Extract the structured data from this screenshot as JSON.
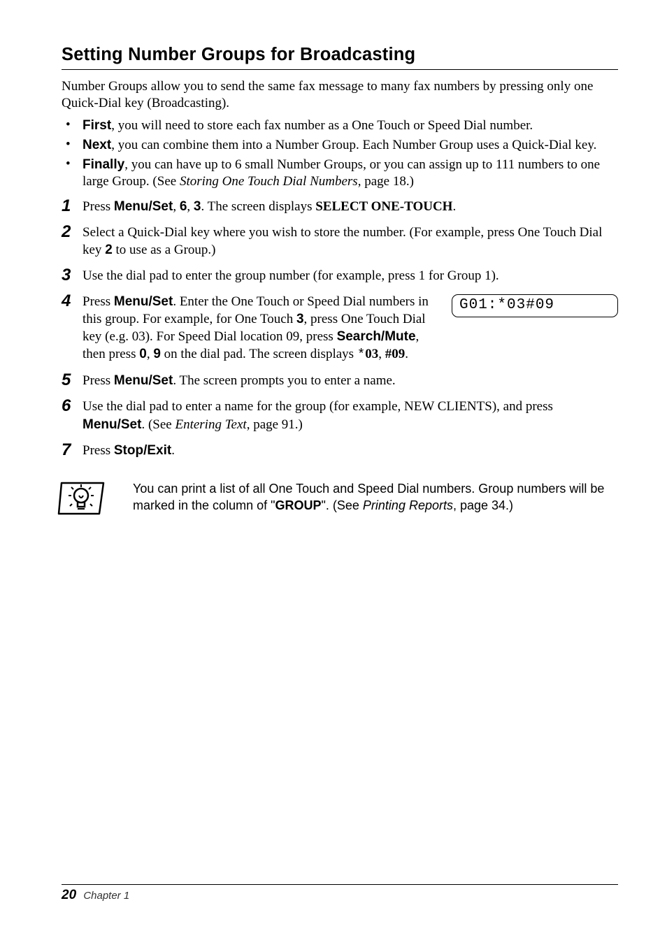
{
  "heading": "Setting Number Groups for Broadcasting",
  "intro": "Number Groups allow you to send the same fax message to many fax numbers by pressing only one Quick-Dial key (Broadcasting).",
  "bullets": [
    {
      "lead": "First",
      "rest": ", you will need to store each fax number as a One Touch or Speed Dial number."
    },
    {
      "lead": "Next",
      "rest": ", you can combine them into a Number Group. Each Number Group uses a Quick-Dial key."
    },
    {
      "lead": "Finally",
      "rest_a": ", you can have up to 6 small Number Groups, or you can assign up to 111 numbers to one large Group. (See ",
      "ref": "Storing One Touch Dial Numbers",
      "rest_b": ", page 18.)"
    }
  ],
  "steps": {
    "s1": {
      "num": "1",
      "a": "Press ",
      "b": "Menu/Set",
      "c": ", ",
      "d": "6",
      "e": ", ",
      "f": "3",
      "g": ". The screen displays ",
      "h": "SELECT ONE-TOUCH",
      "i": "."
    },
    "s2": {
      "num": "2",
      "a": "Select a Quick-Dial key where you wish to store the number. (For example, press One Touch Dial key ",
      "b": "2",
      "c": " to use as a Group.)"
    },
    "s3": {
      "num": "3",
      "a": "Use the dial pad to enter the group number (for example, press 1 for Group 1)."
    },
    "s4": {
      "num": "4",
      "a": "Press ",
      "b": "Menu/Set",
      "c": ". Enter the One Touch or Speed Dial numbers in this group. For example, for One Touch ",
      "d": "3",
      "e": ", press One Touch Dial key (e.g. 03). For Speed Dial location 09, press ",
      "f": "Search/Mute",
      "g": ", then press ",
      "h": "0",
      "i": ", ",
      "j": "9",
      "k": " on the dial pad. The screen displays ",
      "star": "*",
      "l": "03",
      "m": ", ",
      "n": "#09",
      "o": "."
    },
    "s5": {
      "num": "5",
      "a": "Press ",
      "b": "Menu/Set",
      "c": ". The screen prompts you to enter a name."
    },
    "s6": {
      "num": "6",
      "a": "Use the dial pad to enter a name for the group (for example, NEW CLIENTS), and press ",
      "b": "Menu/Set",
      "c": ". (See ",
      "d": "Entering Text",
      "e": ", page 91.)"
    },
    "s7": {
      "num": "7",
      "a": "Press ",
      "b": "Stop/Exit",
      "c": "."
    }
  },
  "lcd": "G01:*03#09",
  "note": {
    "a": "You can print a list of all One Touch and Speed Dial numbers. Group numbers will be marked in the column of \"",
    "b": "GROUP",
    "c": "\". (See ",
    "d": "Printing Reports",
    "e": ", page 34.)"
  },
  "footer": {
    "page": "20",
    "chapter": "Chapter 1"
  },
  "icons": {
    "note": "lightbulb-icon"
  }
}
